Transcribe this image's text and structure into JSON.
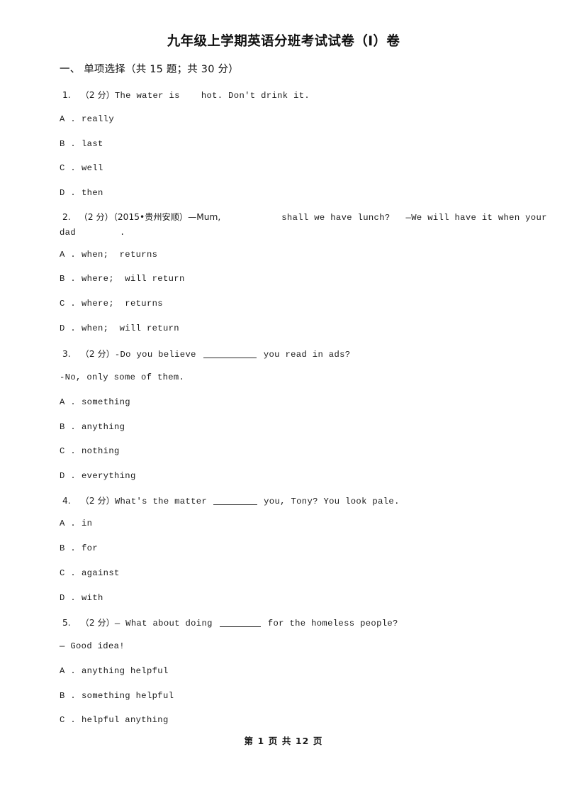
{
  "document": {
    "title": "九年级上学期英语分班考试试卷（I）卷",
    "footer": "第 1 页 共 12 页"
  },
  "section": {
    "heading": "一、  单项选择（共 15 题；共 30 分）"
  },
  "questions": [
    {
      "number": "1.",
      "score": "（2 分）",
      "stem_before": "The water is",
      "blank_type": "space",
      "stem_after": "hot. Don't drink it.",
      "options": [
        {
          "label": "A .",
          "text": "really"
        },
        {
          "label": "B .",
          "text": "last"
        },
        {
          "label": "C .",
          "text": "well"
        },
        {
          "label": "D .",
          "text": "then"
        }
      ]
    },
    {
      "number": "2.",
      "score": "（2 分）",
      "source": "（2015•贵州安顺）",
      "stem_line1_a": "—Mum,",
      "stem_line1_b": "shall we have lunch?",
      "stem_line1_c": "—We will have it when your",
      "stem_line2_a": "dad",
      "stem_line2_b": ".",
      "options": [
        {
          "label": "A .",
          "text": "when;  returns"
        },
        {
          "label": "B .",
          "text": "where;  will return"
        },
        {
          "label": "C .",
          "text": "where;  returns"
        },
        {
          "label": "D .",
          "text": "when;  will return"
        }
      ]
    },
    {
      "number": "3.",
      "score": "（2 分）",
      "stem_before": "-Do you believe",
      "blank_type": "underline",
      "stem_after": "you read in ads?",
      "stem_line2": "-No, only some of them.",
      "options": [
        {
          "label": "A .",
          "text": "something"
        },
        {
          "label": "B .",
          "text": "anything"
        },
        {
          "label": "C .",
          "text": "nothing"
        },
        {
          "label": "D .",
          "text": "everything"
        }
      ]
    },
    {
      "number": "4.",
      "score": "（2 分）",
      "stem_before": "What's the matter",
      "blank_type": "underline",
      "stem_after": "you, Tony? You look pale.",
      "options": [
        {
          "label": "A .",
          "text": "in"
        },
        {
          "label": "B .",
          "text": "for"
        },
        {
          "label": "C .",
          "text": "against"
        },
        {
          "label": "D .",
          "text": "with"
        }
      ]
    },
    {
      "number": "5.",
      "score": "（2 分）",
      "stem_before": "— What about doing",
      "blank_type": "underline",
      "stem_after": "for the homeless people?",
      "stem_line2": "— Good idea!",
      "options": [
        {
          "label": "A .",
          "text": "anything helpful"
        },
        {
          "label": "B .",
          "text": "something helpful"
        },
        {
          "label": "C .",
          "text": "helpful anything"
        }
      ]
    }
  ]
}
